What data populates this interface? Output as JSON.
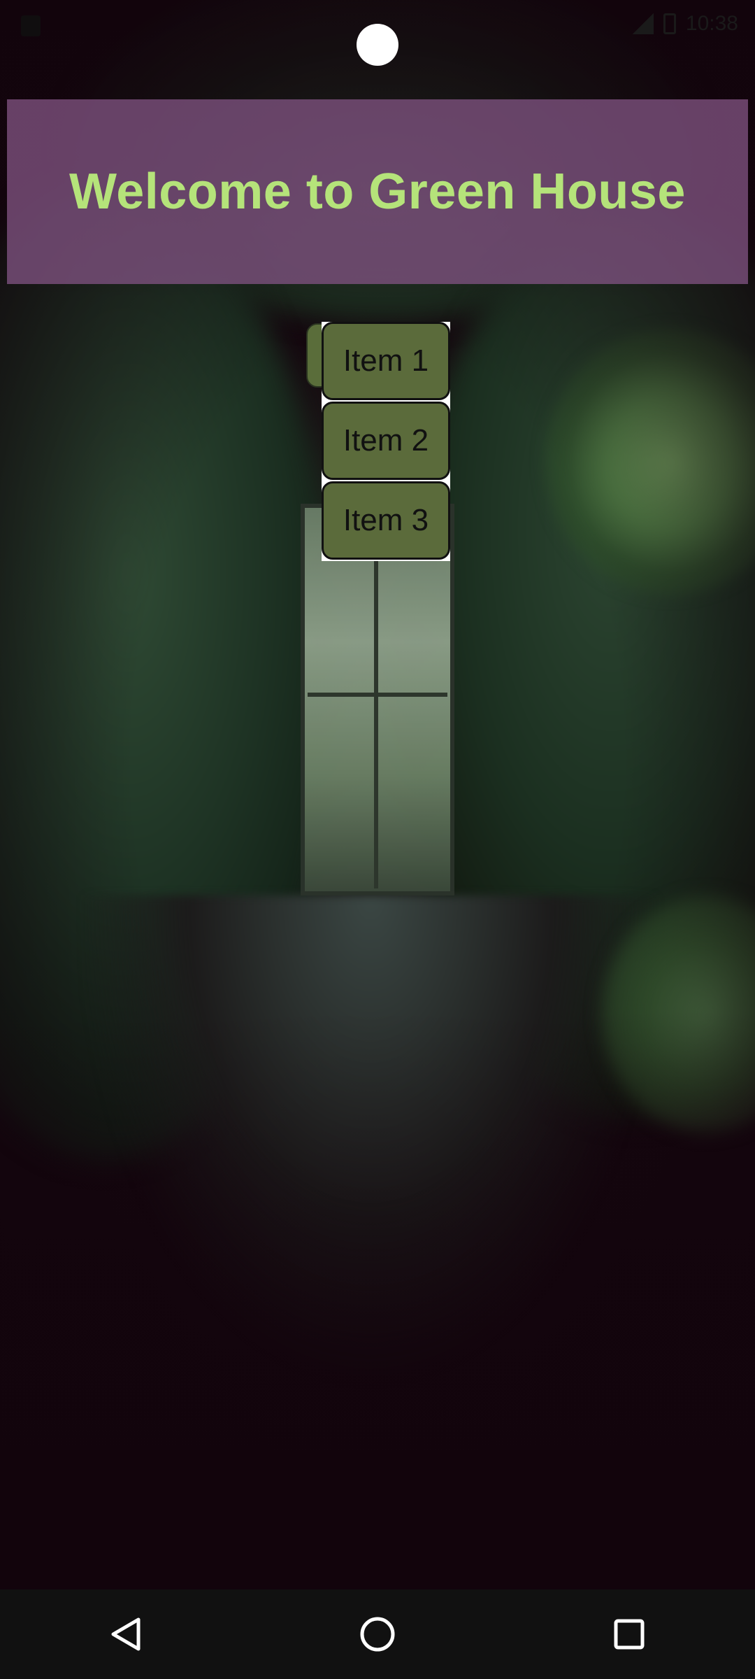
{
  "header": {
    "title": "Welcome to Green House"
  },
  "dropdown": {
    "items": [
      {
        "label": "Item 1"
      },
      {
        "label": "Item 2"
      },
      {
        "label": "Item 3"
      }
    ]
  },
  "status_bar": {
    "time": "10:38"
  },
  "navigation": {
    "back_icon": "back-triangle-icon",
    "home_icon": "home-circle-icon",
    "recents_icon": "recents-square-icon"
  },
  "colors": {
    "banner_bg": "#7f5280",
    "title_text": "#b5e37a",
    "item_bg": "#5b6b3b",
    "nav_bar_bg": "#111111"
  }
}
